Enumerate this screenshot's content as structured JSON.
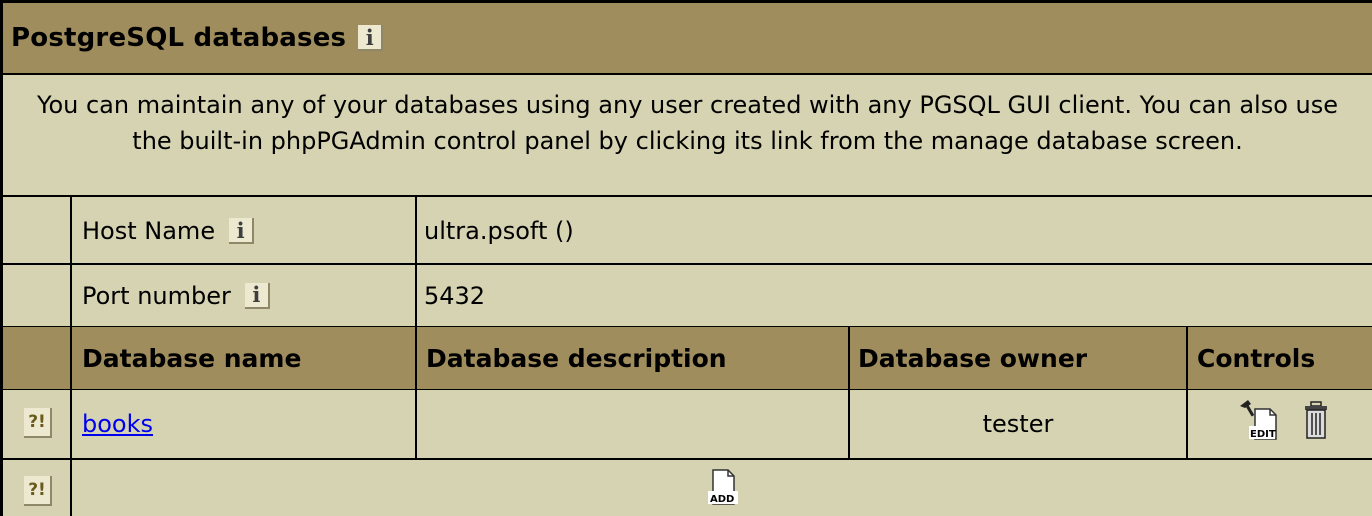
{
  "panel": {
    "title": "PostgreSQL databases",
    "info_icon": "i",
    "description": "You can maintain any of your databases using any user created with any PGSQL GUI client. You can also use the built-in phpPGAdmin control panel by clicking its link from the manage database screen."
  },
  "server_info": [
    {
      "label": "Host Name",
      "value": "ultra.psoft ()"
    },
    {
      "label": "Port number",
      "value": "5432"
    }
  ],
  "table": {
    "columns": [
      "Database name",
      "Database description",
      "Database owner",
      "Controls"
    ],
    "rows": [
      {
        "badge": "?!",
        "name": "books",
        "description": "",
        "owner": "tester",
        "controls": [
          "edit-icon",
          "trash-icon"
        ]
      }
    ],
    "add_row": {
      "badge": "?!",
      "control_label": "ADD",
      "edit_label": "EDIT"
    }
  },
  "colors": {
    "panel_bg": "#d5d3b1",
    "header_bg": "#a08d5d",
    "link": "#0000ee"
  }
}
